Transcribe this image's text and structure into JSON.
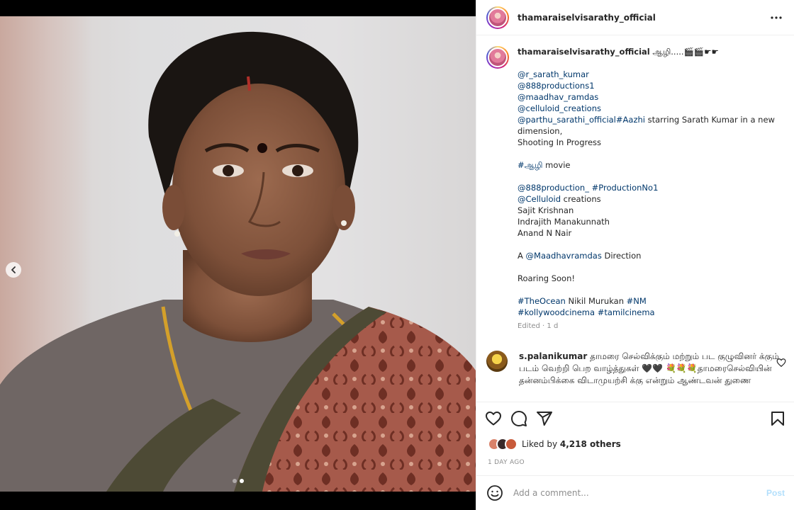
{
  "header": {
    "username": "thamaraiselvisarathy_official",
    "more_icon": "more-horizontal-icon"
  },
  "caption": {
    "username": "thamaraiselvisarathy_official",
    "title": "ஆழி.....🎬🎬☛☛",
    "lines": [
      {
        "parts": [
          {
            "text": "@r_sarath_kumar",
            "link": true
          }
        ]
      },
      {
        "parts": [
          {
            "text": "@888productions1",
            "link": true
          }
        ]
      },
      {
        "parts": [
          {
            "text": "@maadhav_ramdas",
            "link": true
          }
        ]
      },
      {
        "parts": [
          {
            "text": "@celluloid_creations",
            "link": true
          }
        ]
      },
      {
        "parts": [
          {
            "text": "@parthu_sarathi_official",
            "link": true
          },
          {
            "text": "#Aazhi",
            "link": true
          },
          {
            "text": " starring Sarath Kumar in a new dimension,",
            "link": false
          }
        ]
      },
      {
        "parts": [
          {
            "text": "Shooting In Progress",
            "link": false
          }
        ]
      },
      {
        "parts": []
      },
      {
        "parts": [
          {
            "text": "#ஆழி",
            "link": true
          },
          {
            "text": " movie",
            "link": false
          }
        ]
      },
      {
        "parts": []
      },
      {
        "parts": [
          {
            "text": "@888production_",
            "link": true
          },
          {
            "text": " ",
            "link": false
          },
          {
            "text": "#ProductionNo1",
            "link": true
          }
        ]
      },
      {
        "parts": [
          {
            "text": "@Celluloid",
            "link": true
          },
          {
            "text": " creations",
            "link": false
          }
        ]
      },
      {
        "parts": [
          {
            "text": "Sajit Krishnan",
            "link": false
          }
        ]
      },
      {
        "parts": [
          {
            "text": "Indrajith Manakunnath",
            "link": false
          }
        ]
      },
      {
        "parts": [
          {
            "text": "Anand N Nair",
            "link": false
          }
        ]
      },
      {
        "parts": []
      },
      {
        "parts": [
          {
            "text": "A ",
            "link": false
          },
          {
            "text": "@Maadhavramdas",
            "link": true
          },
          {
            "text": " Direction",
            "link": false
          }
        ]
      },
      {
        "parts": []
      },
      {
        "parts": [
          {
            "text": "Roaring Soon!",
            "link": false
          }
        ]
      },
      {
        "parts": []
      },
      {
        "parts": [
          {
            "text": "#TheOcean",
            "link": true
          },
          {
            "text": " Nikil Murukan ",
            "link": false
          },
          {
            "text": "#NM",
            "link": true
          }
        ]
      },
      {
        "parts": [
          {
            "text": "#kollywoodcinema",
            "link": true
          },
          {
            "text": " ",
            "link": false
          },
          {
            "text": "#tamilcinema",
            "link": true
          }
        ]
      }
    ],
    "meta": "Edited · 1 d"
  },
  "comment": {
    "username": "s.palanikumar",
    "text": "தாமரை செல்விக்கும் மற்றும் பட குழுவினர் க்கும் படம் வெற்றி பெற வாழ்த்துகள் 🖤🖤 💐💐💐தாமரைசெல்வியின் தன்னம்பிக்கை விடாமுயற்சி க்கு என்றும் ஆண்டவன் துணை"
  },
  "actions": {
    "like_icon": "heart-icon",
    "comment_icon": "comment-icon",
    "share_icon": "share-icon",
    "save_icon": "bookmark-icon"
  },
  "likes": {
    "prefix": "Liked by ",
    "count": "4,218 others"
  },
  "timeago": "1 DAY AGO",
  "add_comment": {
    "placeholder": "Add a comment...",
    "post_label": "Post"
  },
  "carousel": {
    "total": 2,
    "active": 2
  },
  "colors": {
    "link": "#00376b",
    "muted": "#8e8e8e",
    "post_disabled": "#b2dffc"
  }
}
